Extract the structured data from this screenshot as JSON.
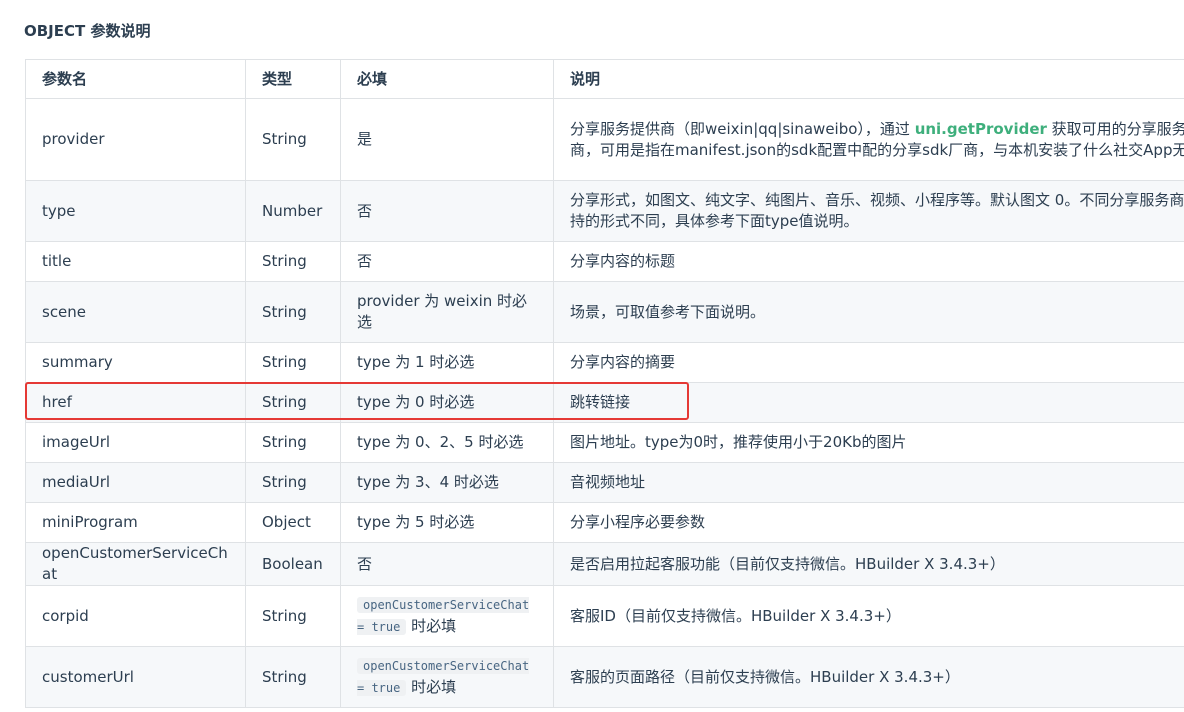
{
  "heading": "OBJECT 参数说明",
  "columns": [
    "参数名",
    "类型",
    "必填",
    "说明"
  ],
  "rows": [
    {
      "name": "provider",
      "type": "String",
      "required": "是",
      "desc_pre": "分享服务提供商（即weixin|qq|sinaweibo），通过 ",
      "desc_link": "uni.getProvider",
      "desc_post": " 获取可用的分享服务商，可用是指在manifest.json的sdk配置中配的分享sdk厂商，与本机安装了什么社交App无关"
    },
    {
      "name": "type",
      "type": "Number",
      "required": "否",
      "desc": "分享形式，如图文、纯文字、纯图片、音乐、视频、小程序等。默认图文 0。不同分享服务商支持的形式不同，具体参考下面type值说明。"
    },
    {
      "name": "title",
      "type": "String",
      "required": "否",
      "desc": "分享内容的标题"
    },
    {
      "name": "scene",
      "type": "String",
      "required": "provider 为 weixin 时必选",
      "desc": "场景，可取值参考下面说明。"
    },
    {
      "name": "summary",
      "type": "String",
      "required": "type 为 1 时必选",
      "desc": "分享内容的摘要"
    },
    {
      "name": "href",
      "type": "String",
      "required": "type 为 0 时必选",
      "desc": "跳转链接"
    },
    {
      "name": "imageUrl",
      "type": "String",
      "required": "type 为 0、2、5 时必选",
      "desc": "图片地址。type为0时，推荐使用小于20Kb的图片"
    },
    {
      "name": "mediaUrl",
      "type": "String",
      "required": "type 为 3、4 时必选",
      "desc": "音视频地址"
    },
    {
      "name": "miniProgram",
      "type": "Object",
      "required": "type 为 5 时必选",
      "desc": "分享小程序必要参数"
    },
    {
      "name": "openCustomerServiceChat",
      "type": "Boolean",
      "required": "否",
      "desc": "是否启用拉起客服功能（目前仅支持微信。HBuilder X 3.4.3+）"
    },
    {
      "name": "corpid",
      "type": "String",
      "required_code": "openCustomerServiceChat = true",
      "required_post": " 时必填",
      "desc": "客服ID（目前仅支持微信。HBuilder X 3.4.3+）"
    },
    {
      "name": "customerUrl",
      "type": "String",
      "required_code": "openCustomerServiceChat = true",
      "required_post": " 时必填",
      "desc": "客服的页面路径（目前仅支持微信。HBuilder X 3.4.3+）"
    }
  ],
  "colors": {
    "link": "#3eaf7c",
    "highlight": "#e53935",
    "text": "#2c3e50",
    "stripe": "#f6f8fa",
    "border": "#dfe2e5"
  }
}
